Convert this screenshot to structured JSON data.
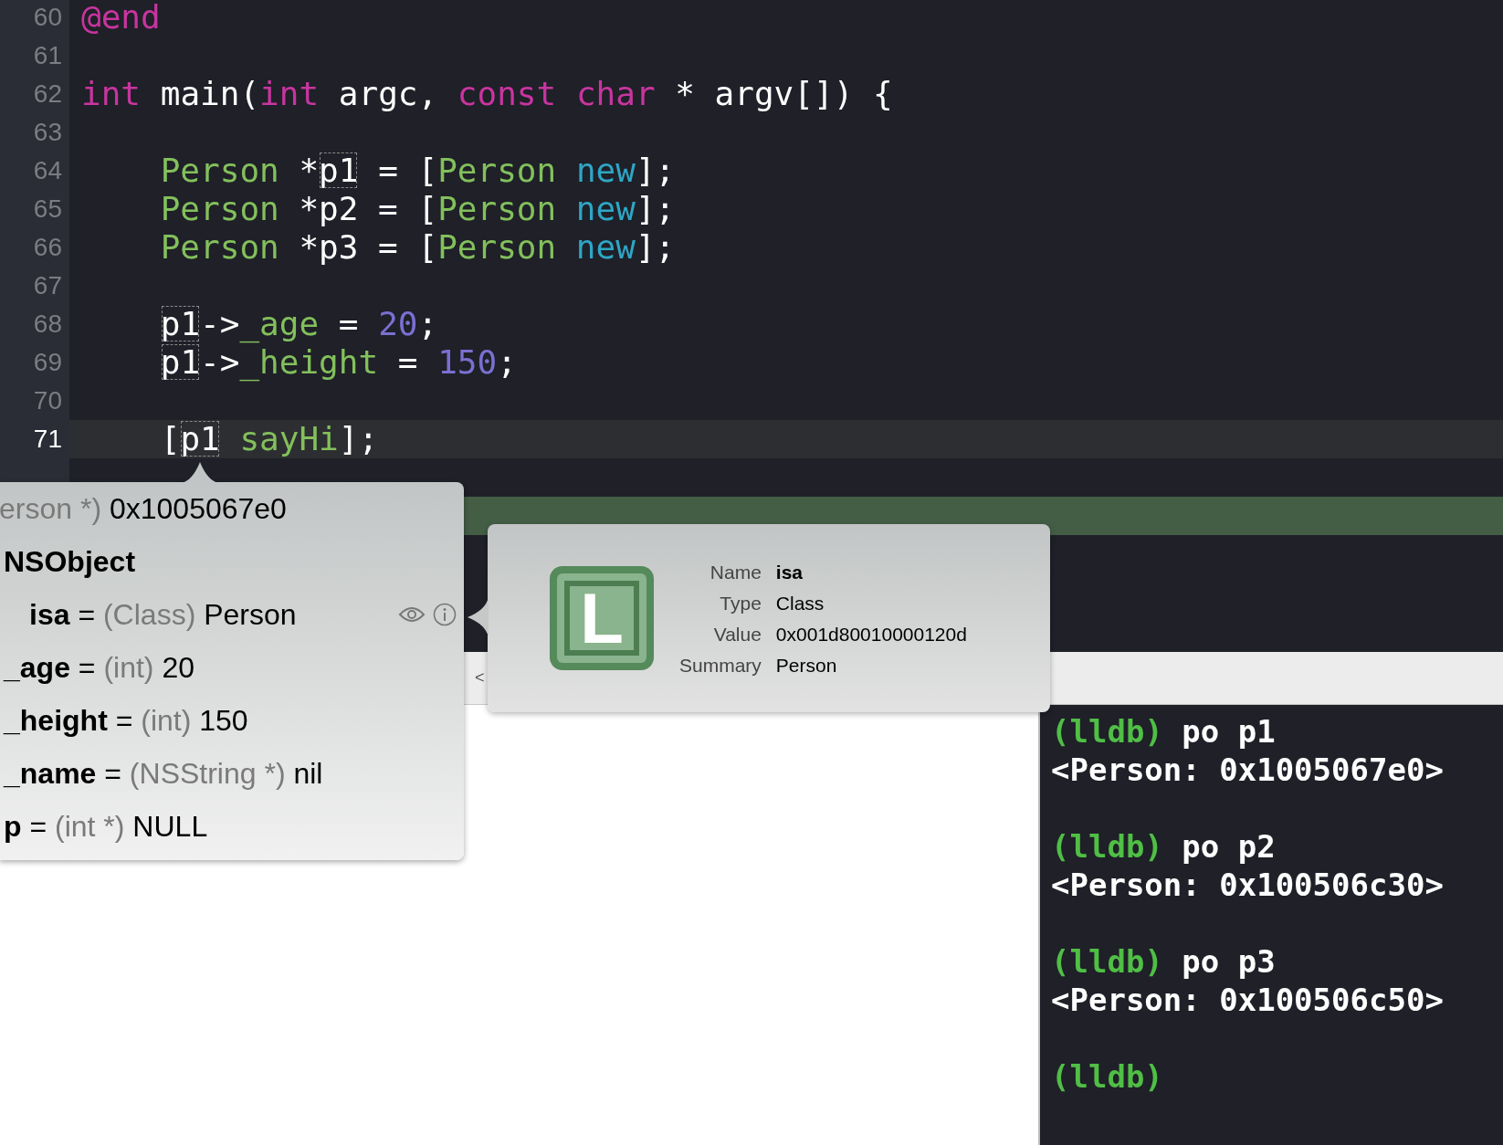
{
  "editor": {
    "lines": [
      {
        "number": "60",
        "current": false,
        "tokens": [
          {
            "text": "@end",
            "kind": "keyword"
          }
        ]
      },
      {
        "number": "61",
        "current": false
      },
      {
        "number": "62",
        "current": false,
        "tokens": [
          {
            "text": "int",
            "kind": "keyword"
          },
          {
            "text": " main(",
            "kind": "plain"
          },
          {
            "text": "int",
            "kind": "keyword"
          },
          {
            "text": " argc, ",
            "kind": "plain"
          },
          {
            "text": "const",
            "kind": "keyword"
          },
          {
            "text": " char",
            "kind": "keyword"
          },
          {
            "text": " * argv[]) {",
            "kind": "plain"
          }
        ]
      },
      {
        "number": "63",
        "current": false
      },
      {
        "number": "64",
        "current": false,
        "tokens": [
          {
            "text": "    Person",
            "kind": "class"
          },
          {
            "text": " *",
            "kind": "plain"
          },
          {
            "text": "p1",
            "kind": "plain",
            "boxed": true
          },
          {
            "text": " = [",
            "kind": "plain"
          },
          {
            "text": "Person",
            "kind": "class"
          },
          {
            "text": " new",
            "kind": "method"
          },
          {
            "text": "];",
            "kind": "plain"
          }
        ]
      },
      {
        "number": "65",
        "current": false,
        "tokens": [
          {
            "text": "    Person",
            "kind": "class"
          },
          {
            "text": " *p2 = [",
            "kind": "plain"
          },
          {
            "text": "Person",
            "kind": "class"
          },
          {
            "text": " new",
            "kind": "method"
          },
          {
            "text": "];",
            "kind": "plain"
          }
        ]
      },
      {
        "number": "66",
        "current": false,
        "tokens": [
          {
            "text": "    Person",
            "kind": "class"
          },
          {
            "text": " *p3 = [",
            "kind": "plain"
          },
          {
            "text": "Person",
            "kind": "class"
          },
          {
            "text": " new",
            "kind": "method"
          },
          {
            "text": "];",
            "kind": "plain"
          }
        ]
      },
      {
        "number": "67",
        "current": false
      },
      {
        "number": "68",
        "current": false,
        "tokens": [
          {
            "text": "    p1",
            "kind": "plain",
            "boxed": true
          },
          {
            "text": "->",
            "kind": "plain"
          },
          {
            "text": "_age",
            "kind": "ivar"
          },
          {
            "text": " = ",
            "kind": "plain"
          },
          {
            "text": "20",
            "kind": "number"
          },
          {
            "text": ";",
            "kind": "plain"
          }
        ]
      },
      {
        "number": "69",
        "current": false,
        "tokens": [
          {
            "text": "    p1",
            "kind": "plain",
            "boxed": true
          },
          {
            "text": "->",
            "kind": "plain"
          },
          {
            "text": "_height",
            "kind": "ivar"
          },
          {
            "text": " = ",
            "kind": "plain"
          },
          {
            "text": "150",
            "kind": "number"
          },
          {
            "text": ";",
            "kind": "plain"
          }
        ]
      },
      {
        "number": "70",
        "current": false
      },
      {
        "number": "71",
        "current": true,
        "tokens": [
          {
            "text": "    [",
            "kind": "plain"
          },
          {
            "text": "p1",
            "kind": "plain",
            "boxed": true
          },
          {
            "text": " sayHi",
            "kind": "ivar"
          },
          {
            "text": "];",
            "kind": "plain"
          }
        ]
      },
      {
        "current": false
      }
    ],
    "paused_line": true
  },
  "debug_bar": {
    "glyph": "<"
  },
  "variable_popover": {
    "header": {
      "type": "erson *)",
      "value": "0x1005067e0"
    },
    "members": [
      {
        "name": "NSObject",
        "children": [
          {
            "name": "isa",
            "separator": "=",
            "type": "(Class)",
            "value": "Person",
            "hovered": true
          }
        ]
      },
      {
        "name": "_age",
        "separator": "=",
        "type": "(int)",
        "value": "20",
        "hovered": false
      },
      {
        "name": "_height",
        "separator": "=",
        "type": "(int)",
        "value": "150",
        "hovered": false
      },
      {
        "name": "_name",
        "separator": "=",
        "type": "(NSString *)",
        "value": "nil",
        "hovered": false
      },
      {
        "name": "p",
        "separator": "=",
        "type": "(int *)",
        "value": "NULL",
        "hovered": false
      }
    ]
  },
  "detail_popover": {
    "badge": "L",
    "fields": [
      {
        "label": "Name",
        "value": "isa",
        "bold": true
      },
      {
        "label": "Type",
        "value": "Class",
        "bold": false
      },
      {
        "label": "Value",
        "value": "0x001d80010000120d",
        "bold": false
      },
      {
        "label": "Summary",
        "value": "Person",
        "bold": false
      }
    ]
  },
  "console": {
    "entries": [
      {
        "prompt": "(lldb)",
        "command": "po p1",
        "output": "<Person: 0x1005067e0>"
      },
      {
        "prompt": "(lldb)",
        "command": "po p2",
        "output": "<Person: 0x100506c30>"
      },
      {
        "prompt": "(lldb)",
        "command": "po p3",
        "output": "<Person: 0x100506c50>"
      },
      {
        "prompt": "(lldb)"
      }
    ]
  }
}
